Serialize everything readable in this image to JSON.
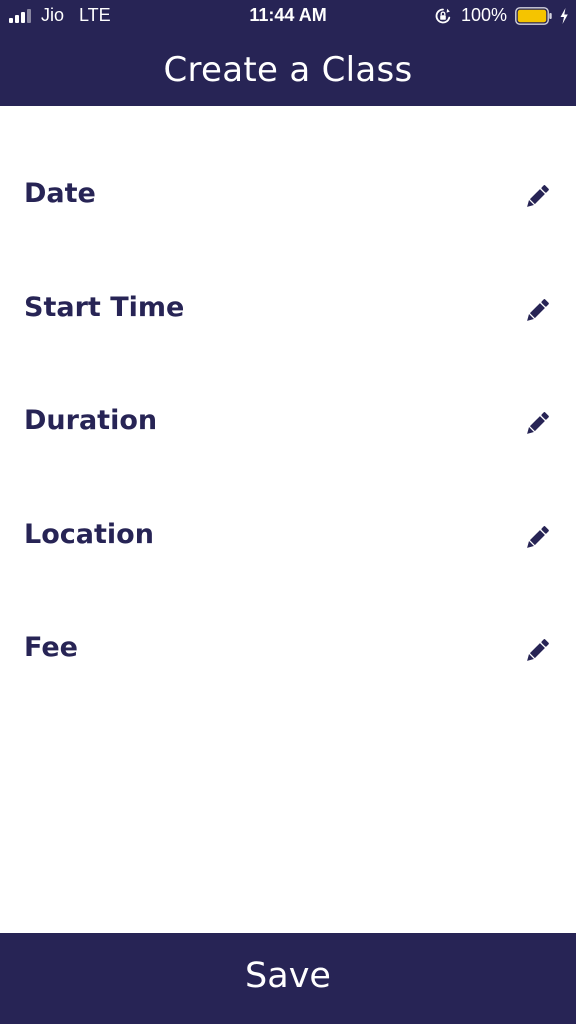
{
  "status_bar": {
    "carrier": "Jio",
    "network": "LTE",
    "time": "11:44 AM",
    "battery_percent": "100%",
    "battery_level": 1.0,
    "battery_color": "#f5c400",
    "icons": [
      "signal-icon",
      "orientation-lock-icon",
      "battery-icon",
      "charging-bolt-icon"
    ]
  },
  "header": {
    "title": "Create a Class",
    "background": "#272455"
  },
  "fields": [
    {
      "label": "Date",
      "icon": "pencil-icon"
    },
    {
      "label": "Start Time",
      "icon": "pencil-icon"
    },
    {
      "label": "Duration",
      "icon": "pencil-icon"
    },
    {
      "label": "Location",
      "icon": "pencil-icon"
    },
    {
      "label": "Fee",
      "icon": "pencil-icon"
    }
  ],
  "footer": {
    "save_label": "Save"
  },
  "colors": {
    "primary": "#272455",
    "text_on_primary": "#ffffff",
    "background": "#ffffff"
  }
}
